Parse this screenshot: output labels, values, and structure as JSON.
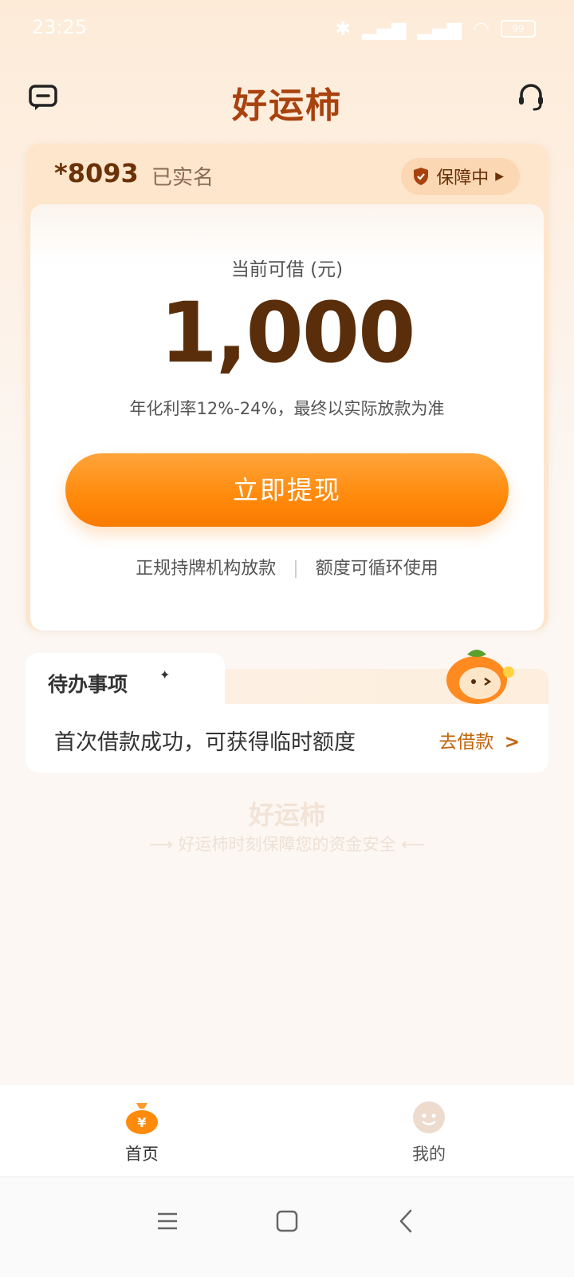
{
  "status_bar": {
    "time": "23:25",
    "battery": "99"
  },
  "header": {
    "title": "好运柿",
    "message_icon": "message-icon",
    "support_icon": "headset-icon"
  },
  "card": {
    "account": "*8093",
    "verified": "已实名",
    "guard_label": "保障中",
    "available_label": "当前可借 (元)",
    "amount": "1,000",
    "rate_text": "年化利率12%-24%，最终以实际放款为准",
    "cta": "立即提现",
    "tip_left": "正规持牌机构放款",
    "tip_right": "额度可循环使用"
  },
  "todo": {
    "title": "待办事项",
    "item_text": "首次借款成功，可获得临时额度",
    "action": "去借款"
  },
  "brand": {
    "name": "好运柿",
    "slogan": "好运柿时刻保障您的资金安全"
  },
  "tabbar": {
    "home": "首页",
    "mine": "我的"
  },
  "colors": {
    "accent": "#ff8a0c",
    "brand": "#a8420e",
    "link": "#c2650c"
  }
}
